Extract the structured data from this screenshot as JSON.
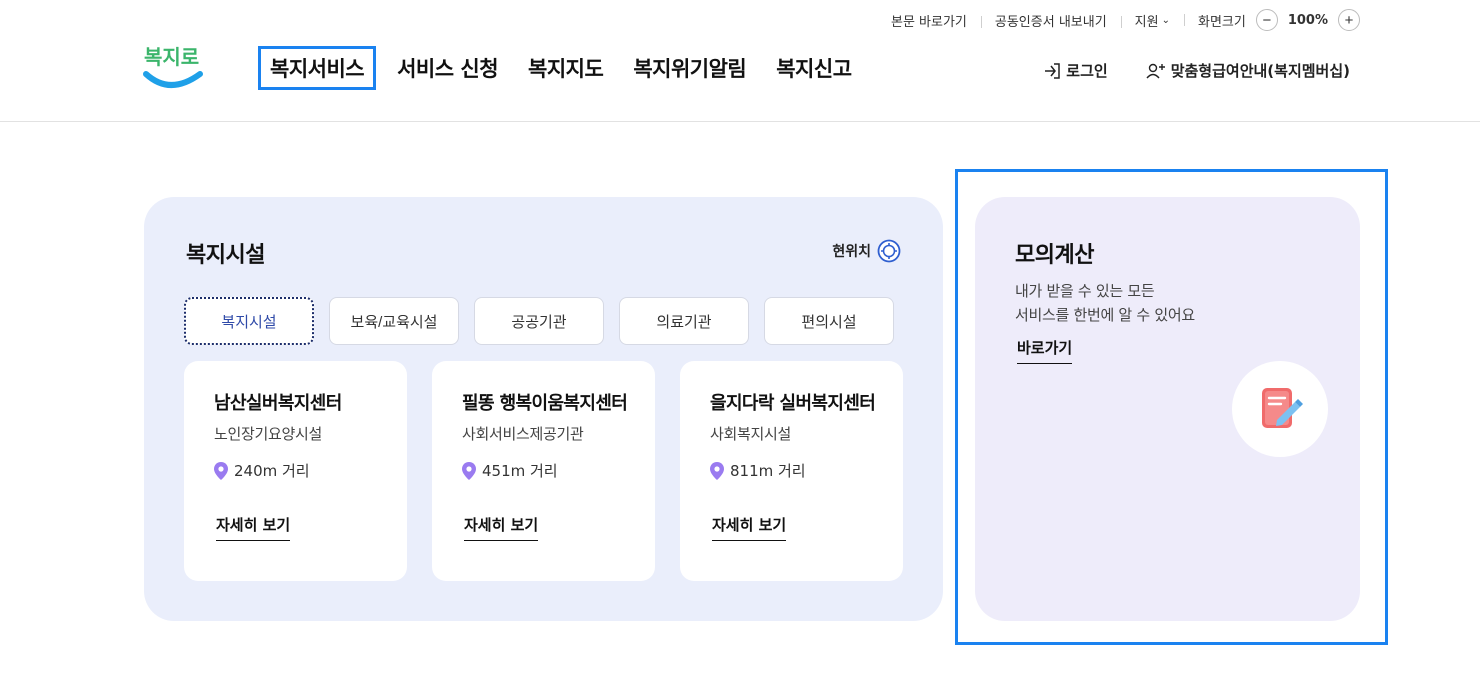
{
  "utility": {
    "skip_to_content": "본문 바로가기",
    "export_certificate": "공동인증서 내보내기",
    "support": "지원",
    "screen_size_label": "화면크기",
    "zoom_out": "−",
    "zoom_value": "100%",
    "zoom_in": "+"
  },
  "header": {
    "logo_text": "복지로",
    "nav": [
      {
        "label": "복지서비스"
      },
      {
        "label": "서비스 신청"
      },
      {
        "label": "복지지도"
      },
      {
        "label": "복지위기알림"
      },
      {
        "label": "복지신고"
      }
    ],
    "login_label": "로그인",
    "membership_label": "맞춤형급여안내(복지멤버십)"
  },
  "facilities": {
    "title": "복지시설",
    "location_label": "현위치",
    "tabs": [
      {
        "label": "복지시설"
      },
      {
        "label": "보육/교육시설"
      },
      {
        "label": "공공기관"
      },
      {
        "label": "의료기관"
      },
      {
        "label": "편의시설"
      }
    ],
    "cards": [
      {
        "name": "남산실버복지센터",
        "type": "노인장기요양시설",
        "distance": "240m 거리",
        "link": "자세히 보기"
      },
      {
        "name": "필똥 행복이움복지센터",
        "type": "사회서비스제공기관",
        "distance": "451m 거리",
        "link": "자세히 보기"
      },
      {
        "name": "을지다락 실버복지센터",
        "type": "사회복지시설",
        "distance": "811m 거리",
        "link": "자세히 보기"
      }
    ]
  },
  "simulation": {
    "title": "모의계산",
    "desc_line1": "내가 받을 수 있는 모든",
    "desc_line2": "서비스를 한번에 알 수 있어요",
    "link": "바로가기"
  },
  "colors": {
    "focus_outline": "#1a82f0",
    "facility_bg": "#eaeefb",
    "simulation_bg": "#eeecfa",
    "logo_blue": "#1fa0e8",
    "logo_green": "#3bb56b",
    "pin_purple": "#9a7bf0",
    "calc_icon_red": "#f06b6b"
  }
}
